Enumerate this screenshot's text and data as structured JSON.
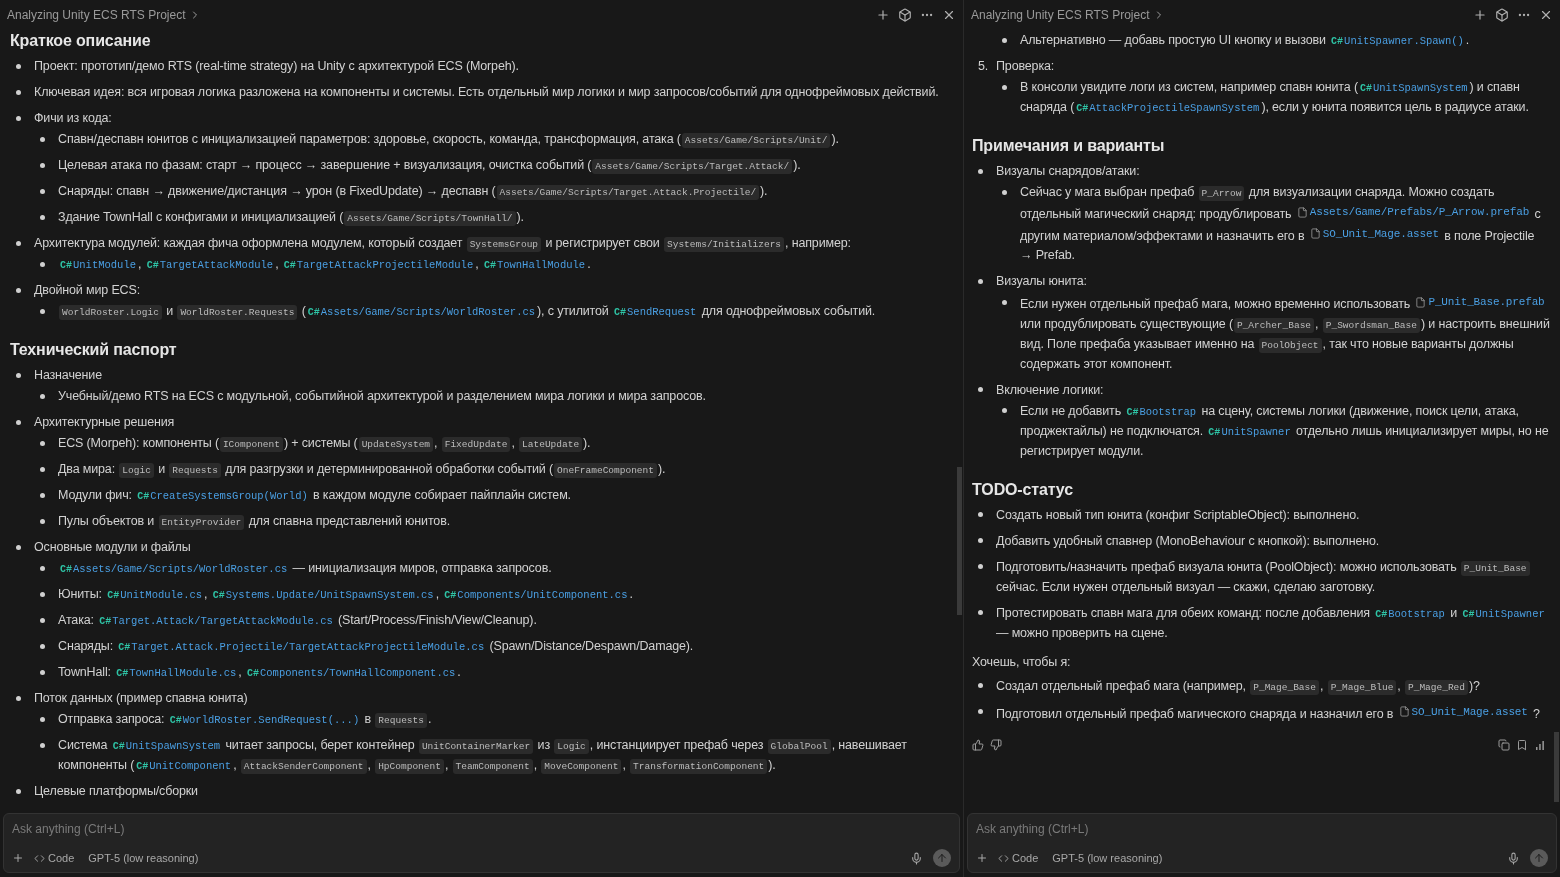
{
  "panes": [
    {
      "header": {
        "title": "Analyzing Unity ECS RTS Project"
      },
      "blocks": [
        {
          "kind": "heading",
          "text": "Краткое описание"
        },
        {
          "kind": "list",
          "items": [
            {
              "segments": [
                {
                  "kind": "text",
                  "text": "Проект: прототип/демо RTS (real-time strategy) на Unity с архитектурой ECS (Morpeh)."
                }
              ]
            },
            {
              "segments": [
                {
                  "kind": "text",
                  "text": "Ключевая идея: вся игровая логика разложена на компоненты и системы. Есть отдельный мир логики и мир запросов/событий для однофреймовых действий."
                }
              ]
            },
            {
              "segments": [
                {
                  "kind": "text",
                  "text": "Фичи из кода:"
                }
              ],
              "children": [
                {
                  "segments": [
                    {
                      "kind": "text",
                      "text": "Спавн/деспавн юнитов с инициализацией параметров: здоровье, скорость, команда, трансформация, атака ("
                    },
                    {
                      "kind": "code",
                      "text": "Assets/Game/Scripts/Unit/"
                    },
                    {
                      "kind": "text",
                      "text": ")."
                    }
                  ]
                },
                {
                  "segments": [
                    {
                      "kind": "text",
                      "text": "Целевая атака по фазам: старт → процесс → завершение + визуализация, очистка событий ("
                    },
                    {
                      "kind": "code",
                      "text": "Assets/Game/Scripts/Target.Attack/"
                    },
                    {
                      "kind": "text",
                      "text": ")."
                    }
                  ]
                },
                {
                  "segments": [
                    {
                      "kind": "text",
                      "text": "Снаряды: спавн → движение/дистанция → урон (в FixedUpdate) → деспавн ("
                    },
                    {
                      "kind": "code",
                      "text": "Assets/Game/Scripts/Target.Attack.Projectile/"
                    },
                    {
                      "kind": "text",
                      "text": ")."
                    }
                  ]
                },
                {
                  "segments": [
                    {
                      "kind": "text",
                      "text": "Здание TownHall с конфигами и инициализацией ("
                    },
                    {
                      "kind": "code",
                      "text": "Assets/Game/Scripts/TownHall/"
                    },
                    {
                      "kind": "text",
                      "text": ")."
                    }
                  ]
                }
              ]
            },
            {
              "segments": [
                {
                  "kind": "text",
                  "text": "Архитектура модулей: каждая фича оформлена модулем, который создает "
                },
                {
                  "kind": "code",
                  "text": "SystemsGroup"
                },
                {
                  "kind": "text",
                  "text": " и регистрирует свои "
                },
                {
                  "kind": "code",
                  "text": "Systems/Initializers"
                },
                {
                  "kind": "text",
                  "text": ", например:"
                }
              ],
              "children": [
                {
                  "segments": [
                    {
                      "kind": "cs",
                      "badge": "C#",
                      "text": "UnitModule"
                    },
                    {
                      "kind": "text",
                      "text": ", "
                    },
                    {
                      "kind": "cs",
                      "badge": "C#",
                      "text": "TargetAttackModule"
                    },
                    {
                      "kind": "text",
                      "text": ", "
                    },
                    {
                      "kind": "cs",
                      "badge": "C#",
                      "text": "TargetAttackProjectileModule"
                    },
                    {
                      "kind": "text",
                      "text": ", "
                    },
                    {
                      "kind": "cs",
                      "badge": "C#",
                      "text": "TownHallModule"
                    },
                    {
                      "kind": "text",
                      "text": "."
                    }
                  ]
                }
              ]
            },
            {
              "segments": [
                {
                  "kind": "text",
                  "text": "Двойной мир ECS:"
                }
              ],
              "children": [
                {
                  "segments": [
                    {
                      "kind": "code",
                      "text": "WorldRoster.Logic"
                    },
                    {
                      "kind": "text",
                      "text": " и "
                    },
                    {
                      "kind": "code",
                      "text": "WorldRoster.Requests"
                    },
                    {
                      "kind": "text",
                      "text": " ("
                    },
                    {
                      "kind": "cs",
                      "badge": "C#",
                      "text": "Assets/Game/Scripts/WorldRoster.cs"
                    },
                    {
                      "kind": "text",
                      "text": "), с утилитой "
                    },
                    {
                      "kind": "cs",
                      "badge": "C#",
                      "text": "SendRequest"
                    },
                    {
                      "kind": "text",
                      "text": " для однофреймовых событий."
                    }
                  ]
                }
              ]
            }
          ]
        },
        {
          "kind": "heading",
          "text": "Технический паспорт"
        },
        {
          "kind": "list",
          "items": [
            {
              "segments": [
                {
                  "kind": "text",
                  "text": "Назначение"
                }
              ],
              "children": [
                {
                  "segments": [
                    {
                      "kind": "text",
                      "text": "Учебный/демо RTS на ECS с модульной, событийной архитектурой и разделением мира логики и мира запросов."
                    }
                  ]
                }
              ]
            },
            {
              "segments": [
                {
                  "kind": "text",
                  "text": "Архитектурные решения"
                }
              ],
              "children": [
                {
                  "segments": [
                    {
                      "kind": "text",
                      "text": "ECS (Morpeh): компоненты ("
                    },
                    {
                      "kind": "code",
                      "text": "IComponent"
                    },
                    {
                      "kind": "text",
                      "text": ") + системы ("
                    },
                    {
                      "kind": "code",
                      "text": "UpdateSystem"
                    },
                    {
                      "kind": "text",
                      "text": ", "
                    },
                    {
                      "kind": "code",
                      "text": "FixedUpdate"
                    },
                    {
                      "kind": "text",
                      "text": ", "
                    },
                    {
                      "kind": "code",
                      "text": "LateUpdate"
                    },
                    {
                      "kind": "text",
                      "text": ")."
                    }
                  ]
                },
                {
                  "segments": [
                    {
                      "kind": "text",
                      "text": "Два мира: "
                    },
                    {
                      "kind": "code",
                      "text": "Logic"
                    },
                    {
                      "kind": "text",
                      "text": " и "
                    },
                    {
                      "kind": "code",
                      "text": "Requests"
                    },
                    {
                      "kind": "text",
                      "text": " для разгрузки и детерминированной обработки событий ("
                    },
                    {
                      "kind": "code",
                      "text": "OneFrameComponent"
                    },
                    {
                      "kind": "text",
                      "text": ")."
                    }
                  ]
                },
                {
                  "segments": [
                    {
                      "kind": "text",
                      "text": "Модули фич: "
                    },
                    {
                      "kind": "cs",
                      "badge": "C#",
                      "text": "CreateSystemsGroup(World)"
                    },
                    {
                      "kind": "text",
                      "text": " в каждом модуле собирает пайплайн систем."
                    }
                  ]
                },
                {
                  "segments": [
                    {
                      "kind": "text",
                      "text": "Пулы объектов и "
                    },
                    {
                      "kind": "code",
                      "text": "EntityProvider"
                    },
                    {
                      "kind": "text",
                      "text": " для спавна представлений юнитов."
                    }
                  ]
                }
              ]
            },
            {
              "segments": [
                {
                  "kind": "text",
                  "text": "Основные модули и файлы"
                }
              ],
              "children": [
                {
                  "segments": [
                    {
                      "kind": "cs",
                      "badge": "C#",
                      "text": "Assets/Game/Scripts/WorldRoster.cs"
                    },
                    {
                      "kind": "text",
                      "text": " — инициализация миров, отправка запросов."
                    }
                  ]
                },
                {
                  "segments": [
                    {
                      "kind": "text",
                      "text": "Юниты: "
                    },
                    {
                      "kind": "cs",
                      "badge": "C#",
                      "text": "UnitModule.cs"
                    },
                    {
                      "kind": "text",
                      "text": ", "
                    },
                    {
                      "kind": "cs",
                      "badge": "C#",
                      "text": "Systems.Update/UnitSpawnSystem.cs"
                    },
                    {
                      "kind": "text",
                      "text": ", "
                    },
                    {
                      "kind": "cs",
                      "badge": "C#",
                      "text": "Components/UnitComponent.cs"
                    },
                    {
                      "kind": "text",
                      "text": "."
                    }
                  ]
                },
                {
                  "segments": [
                    {
                      "kind": "text",
                      "text": "Атака: "
                    },
                    {
                      "kind": "cs",
                      "badge": "C#",
                      "text": "Target.Attack/TargetAttackModule.cs"
                    },
                    {
                      "kind": "text",
                      "text": " (Start/Process/Finish/View/Cleanup)."
                    }
                  ]
                },
                {
                  "segments": [
                    {
                      "kind": "text",
                      "text": "Снаряды: "
                    },
                    {
                      "kind": "cs",
                      "badge": "C#",
                      "text": "Target.Attack.Projectile/TargetAttackProjectileModule.cs"
                    },
                    {
                      "kind": "text",
                      "text": " (Spawn/Distance/Despawn/Damage)."
                    }
                  ]
                },
                {
                  "segments": [
                    {
                      "kind": "text",
                      "text": "TownHall: "
                    },
                    {
                      "kind": "cs",
                      "badge": "C#",
                      "text": "TownHallModule.cs"
                    },
                    {
                      "kind": "text",
                      "text": ", "
                    },
                    {
                      "kind": "cs",
                      "badge": "C#",
                      "text": "Components/TownHallComponent.cs"
                    },
                    {
                      "kind": "text",
                      "text": "."
                    }
                  ]
                }
              ]
            },
            {
              "segments": [
                {
                  "kind": "text",
                  "text": "Поток данных (пример спавна юнита)"
                }
              ],
              "children": [
                {
                  "segments": [
                    {
                      "kind": "text",
                      "text": "Отправка запроса: "
                    },
                    {
                      "kind": "cs",
                      "badge": "C#",
                      "text": "WorldRoster.SendRequest(...)"
                    },
                    {
                      "kind": "text",
                      "text": " в "
                    },
                    {
                      "kind": "code",
                      "text": "Requests"
                    },
                    {
                      "kind": "text",
                      "text": "."
                    }
                  ]
                },
                {
                  "segments": [
                    {
                      "kind": "text",
                      "text": "Система "
                    },
                    {
                      "kind": "cs",
                      "badge": "C#",
                      "text": "UnitSpawnSystem"
                    },
                    {
                      "kind": "text",
                      "text": " читает запросы, берет контейнер "
                    },
                    {
                      "kind": "code",
                      "text": "UnitContainerMarker"
                    },
                    {
                      "kind": "text",
                      "text": " из "
                    },
                    {
                      "kind": "code",
                      "text": "Logic"
                    },
                    {
                      "kind": "text",
                      "text": ", инстанциирует префаб через "
                    },
                    {
                      "kind": "code",
                      "text": "GlobalPool"
                    },
                    {
                      "kind": "text",
                      "text": ", навешивает компоненты ("
                    },
                    {
                      "kind": "cs",
                      "badge": "C#",
                      "text": "UnitComponent"
                    },
                    {
                      "kind": "text",
                      "text": ", "
                    },
                    {
                      "kind": "code",
                      "text": "AttackSenderComponent"
                    },
                    {
                      "kind": "text",
                      "text": ", "
                    },
                    {
                      "kind": "code",
                      "text": "HpComponent"
                    },
                    {
                      "kind": "text",
                      "text": ", "
                    },
                    {
                      "kind": "code",
                      "text": "TeamComponent"
                    },
                    {
                      "kind": "text",
                      "text": ", "
                    },
                    {
                      "kind": "code",
                      "text": "MoveComponent"
                    },
                    {
                      "kind": "text",
                      "text": ", "
                    },
                    {
                      "kind": "code",
                      "text": "TransformationComponent"
                    },
                    {
                      "kind": "text",
                      "text": ")."
                    }
                  ]
                }
              ]
            },
            {
              "segments": [
                {
                  "kind": "text",
                  "text": "Целевые платформы/сборки"
                }
              ]
            }
          ]
        }
      ],
      "composer": {
        "placeholder": "Ask anything (Ctrl+L)",
        "mode": "Code",
        "model": "GPT-5 (low reasoning)"
      }
    },
    {
      "header": {
        "title": "Analyzing Unity ECS RTS Project"
      },
      "blocks": [
        {
          "kind": "list",
          "items": [
            {
              "children": [
                {
                  "segments": [
                    {
                      "kind": "text",
                      "text": "Альтернативно — добавь простую UI кнопку и вызови "
                    },
                    {
                      "kind": "cs",
                      "badge": "C#",
                      "text": "UnitSpawner.Spawn()"
                    },
                    {
                      "kind": "text",
                      "text": "."
                    }
                  ]
                }
              ]
            },
            {
              "number": "5.",
              "segments": [
                {
                  "kind": "text",
                  "text": "Проверка:"
                }
              ],
              "children": [
                {
                  "segments": [
                    {
                      "kind": "text",
                      "text": "В консоли увидите логи из систем, например спавн юнита ("
                    },
                    {
                      "kind": "cs",
                      "badge": "C#",
                      "text": "UnitSpawnSystem"
                    },
                    {
                      "kind": "text",
                      "text": ") и спавн снаряда ("
                    },
                    {
                      "kind": "cs",
                      "badge": "C#",
                      "text": "AttackProjectileSpawnSystem"
                    },
                    {
                      "kind": "text",
                      "text": "), если у юнита появится цель в радиусе атаки."
                    }
                  ]
                }
              ]
            }
          ]
        },
        {
          "kind": "heading",
          "text": "Примечания и варианты"
        },
        {
          "kind": "list",
          "items": [
            {
              "segments": [
                {
                  "kind": "text",
                  "text": "Визуалы снарядов/атаки:"
                }
              ],
              "children": [
                {
                  "segments": [
                    {
                      "kind": "text",
                      "text": "Сейчас у мага выбран префаб "
                    },
                    {
                      "kind": "code",
                      "text": "P_Arrow"
                    },
                    {
                      "kind": "text",
                      "text": " для визуализации снаряда. Можно создать отдельный магический снаряд: продублировать "
                    },
                    {
                      "kind": "file",
                      "text": "Assets/Game/Prefabs/P_Arrow.prefab"
                    },
                    {
                      "kind": "text",
                      "text": " с другим материалом/эффектами и назначить его в "
                    },
                    {
                      "kind": "file",
                      "text": "SO_Unit_Mage.asset"
                    },
                    {
                      "kind": "text",
                      "text": " в поле Projectile → Prefab."
                    }
                  ]
                }
              ]
            },
            {
              "segments": [
                {
                  "kind": "text",
                  "text": "Визуалы юнита:"
                }
              ],
              "children": [
                {
                  "segments": [
                    {
                      "kind": "text",
                      "text": "Если нужен отдельный префаб мага, можно временно использовать "
                    },
                    {
                      "kind": "file",
                      "text": "P_Unit_Base.prefab"
                    },
                    {
                      "kind": "text",
                      "text": " или продублировать существующие ("
                    },
                    {
                      "kind": "code",
                      "text": "P_Archer_Base"
                    },
                    {
                      "kind": "text",
                      "text": ", "
                    },
                    {
                      "kind": "code",
                      "text": "P_Swordsman_Base"
                    },
                    {
                      "kind": "text",
                      "text": ") и настроить внешний вид. Поле префаба указывает именно на "
                    },
                    {
                      "kind": "code",
                      "text": "PoolObject"
                    },
                    {
                      "kind": "text",
                      "text": ", так что новые варианты должны содержать этот компонент."
                    }
                  ]
                }
              ]
            },
            {
              "segments": [
                {
                  "kind": "text",
                  "text": "Включение логики:"
                }
              ],
              "children": [
                {
                  "segments": [
                    {
                      "kind": "text",
                      "text": "Если не добавить "
                    },
                    {
                      "kind": "cs",
                      "badge": "C#",
                      "text": "Bootstrap"
                    },
                    {
                      "kind": "text",
                      "text": " на сцену, системы логики (движение, поиск цели, атака, проджектайлы) не подключатся. "
                    },
                    {
                      "kind": "cs",
                      "badge": "C#",
                      "text": "UnitSpawner"
                    },
                    {
                      "kind": "text",
                      "text": " отдельно лишь инициализирует миры, но не регистрирует модули."
                    }
                  ]
                }
              ]
            }
          ]
        },
        {
          "kind": "heading",
          "text": "TODO-статус"
        },
        {
          "kind": "list",
          "items": [
            {
              "segments": [
                {
                  "kind": "text",
                  "text": "Создать новый тип юнита (конфиг ScriptableObject): выполнено."
                }
              ]
            },
            {
              "segments": [
                {
                  "kind": "text",
                  "text": "Добавить удобный спавнер (MonoBehaviour с кнопкой): выполнено."
                }
              ]
            },
            {
              "segments": [
                {
                  "kind": "text",
                  "text": "Подготовить/назначить префаб визуала юнита (PoolObject): можно использовать "
                },
                {
                  "kind": "code",
                  "text": "P_Unit_Base"
                },
                {
                  "kind": "text",
                  "text": " сейчас. Если нужен отдельный визуал — скажи, сделаю заготовку."
                }
              ]
            },
            {
              "segments": [
                {
                  "kind": "text",
                  "text": "Протестировать спавн мага для обеих команд: после добавления "
                },
                {
                  "kind": "cs",
                  "badge": "C#",
                  "text": "Bootstrap"
                },
                {
                  "kind": "text",
                  "text": " и "
                },
                {
                  "kind": "cs",
                  "badge": "C#",
                  "text": "UnitSpawner"
                },
                {
                  "kind": "text",
                  "text": " — можно проверить на сцене."
                }
              ]
            }
          ]
        },
        {
          "kind": "paragraph",
          "segments": [
            {
              "kind": "text",
              "text": "Хочешь, чтобы я:"
            }
          ]
        },
        {
          "kind": "list",
          "items": [
            {
              "segments": [
                {
                  "kind": "text",
                  "text": "Создал отдельный префаб мага (например, "
                },
                {
                  "kind": "code",
                  "text": "P_Mage_Base"
                },
                {
                  "kind": "text",
                  "text": ", "
                },
                {
                  "kind": "code",
                  "text": "P_Mage_Blue"
                },
                {
                  "kind": "text",
                  "text": ", "
                },
                {
                  "kind": "code",
                  "text": "P_Mage_Red"
                },
                {
                  "kind": "text",
                  "text": ")?"
                }
              ]
            },
            {
              "segments": [
                {
                  "kind": "text",
                  "text": "Подготовил отдельный префаб магического снаряда и назначил его в "
                },
                {
                  "kind": "file",
                  "text": "SO_Unit_Mage.asset"
                },
                {
                  "kind": "text",
                  "text": " ?"
                }
              ]
            }
          ]
        }
      ],
      "message_actions": true,
      "composer": {
        "placeholder": "Ask anything (Ctrl+L)",
        "mode": "Code",
        "model": "GPT-5 (low reasoning)"
      }
    }
  ]
}
